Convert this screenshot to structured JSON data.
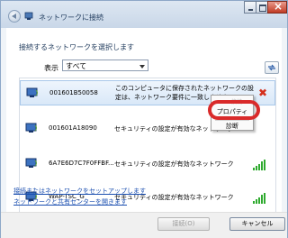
{
  "window": {
    "title": "ネットワークに接続",
    "heading": "接続するネットワークを選択します"
  },
  "filter": {
    "label": "表示",
    "value": "すべて"
  },
  "networks": [
    {
      "ssid": "001601B50058",
      "desc": "このコンピュータに保存されたネットワークの設定は、ネットワーク要件に一致しません。",
      "status": "error"
    },
    {
      "ssid": "001601A18090",
      "desc": "セキュリティの設定が有効なネットワーク",
      "status": "ok"
    },
    {
      "ssid": "6A7E6D7C7F0FFBF...",
      "desc": "セキュリティの設定が有効なネットワーク",
      "status": "ok"
    },
    {
      "ssid": "WAP-TSC_G",
      "desc": "セキュリティの設定が有効なネットワーク",
      "status": "ok"
    }
  ],
  "context_menu": {
    "faint": "接続",
    "property": "プロパティ",
    "diagnose": "診断"
  },
  "links": {
    "setup": "接続またはネットワークをセットアップします",
    "center": "ネットワークと共有センターを開きます"
  },
  "buttons": {
    "connect": "接続(O)",
    "cancel": "キャンセル"
  },
  "colors": {
    "accent": "#1e395b",
    "link": "#1b4fb0",
    "error": "#d4301c",
    "signal": "#2faa2f",
    "highlight": "#d92a2a"
  }
}
